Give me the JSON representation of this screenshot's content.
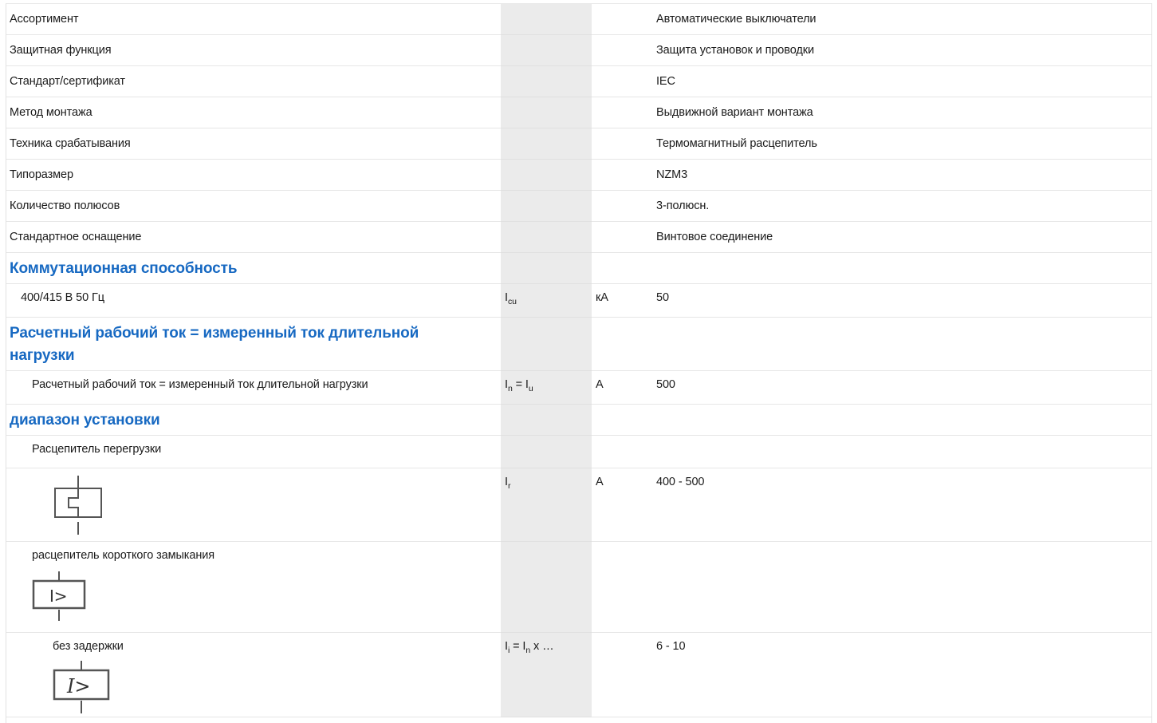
{
  "rows": {
    "r1": {
      "label": "Ассортимент",
      "value": "Автоматические выключатели"
    },
    "r2": {
      "label": "Защитная функция",
      "value": "Защита установок и проводки"
    },
    "r3": {
      "label": "Стандарт/сертификат",
      "value": "IEC"
    },
    "r4": {
      "label": "Метод монтажа",
      "value": "Выдвижной вариант монтажа"
    },
    "r5": {
      "label": "Техника срабатывания",
      "value": "Термомагнитный расцепитель"
    },
    "r6": {
      "label": "Типоразмер",
      "value": "NZM3"
    },
    "r7": {
      "label": "Количество полюсов",
      "value": "3-полюсн."
    },
    "r8": {
      "label": "Стандартное оснащение",
      "value": "Винтовое соединение"
    }
  },
  "sections": {
    "switching": "Коммутационная способность",
    "rated_current": "Расчетный рабочий ток = измеренный ток длительной нагрузки",
    "setting_range": "диапазон установки"
  },
  "switching_row": {
    "label": "400/415 В 50 Гц",
    "symbol_main": "I",
    "symbol_sub": "cu",
    "unit": "кА",
    "value": "50"
  },
  "rated_row": {
    "label": "Расчетный рабочий ток = измеренный ток длительной нагрузки",
    "symbol_a": "I",
    "symbol_a_sub": "n",
    "symbol_eq": " = ",
    "symbol_b": "I",
    "symbol_b_sub": "u",
    "unit": "A",
    "value": "500"
  },
  "overload": {
    "label": "Расцепитель перегрузки"
  },
  "overload_icon_row": {
    "symbol_main": "I",
    "symbol_sub": "r",
    "unit": "A",
    "value": "400 - 500"
  },
  "short_circuit": {
    "label": "расцепитель короткого замыкания",
    "icon_text": "I>"
  },
  "no_delay": {
    "label": "без задержки",
    "symbol_a": "I",
    "symbol_a_sub": "i",
    "symbol_eq": " = ",
    "symbol_b": "I",
    "symbol_b_sub": "n",
    "symbol_tail": " x …",
    "value": "6 - 10",
    "icon_text": "I>"
  }
}
